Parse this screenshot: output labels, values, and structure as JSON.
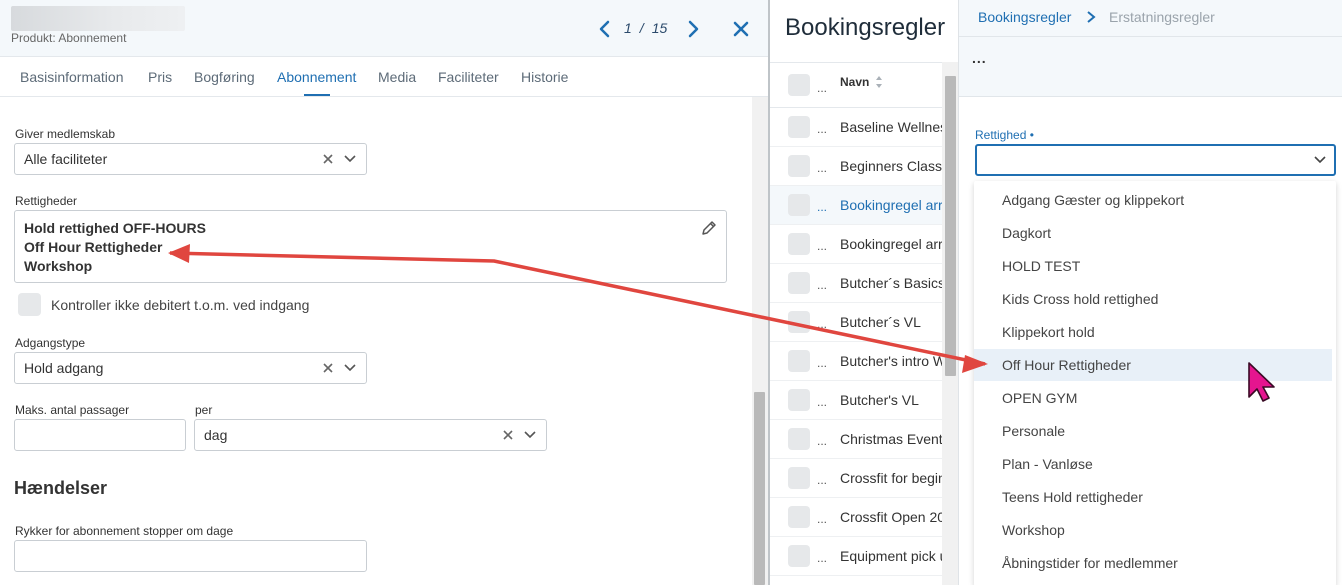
{
  "left_panel": {
    "subtitle": "Produkt: Abonnement",
    "pager": {
      "current": "1",
      "separator": "/",
      "total": "15"
    },
    "tabs": [
      {
        "label": "Basisinformation"
      },
      {
        "label": "Pris"
      },
      {
        "label": "Bogføring"
      },
      {
        "label": "Abonnement",
        "active": true
      },
      {
        "label": "Media"
      },
      {
        "label": "Faciliteter"
      },
      {
        "label": "Historie"
      }
    ],
    "form": {
      "membership_label": "Giver medlemskab",
      "membership_value": "Alle faciliteter",
      "rights_label": "Rettigheder",
      "rights_values": [
        "Hold rettighed OFF-HOURS",
        "Off Hour Rettigheder",
        "Workshop"
      ],
      "check_label": "Kontroller ikke debitert t.o.m. ved indgang",
      "access_label": "Adgangstype",
      "access_value": "Hold adgang",
      "max_label": "Maks. antal passager",
      "max_value": "",
      "per_label": "per",
      "per_value": "dag",
      "events_heading": "Hændelser",
      "reminder_label": "Rykker for abonnement stopper om dage",
      "reminder_value": ""
    }
  },
  "middle_panel": {
    "title": "Bookingsregler",
    "column_header": "Navn",
    "row_dots": "...",
    "rows": [
      {
        "name": "Baseline Wellness"
      },
      {
        "name": "Beginners Class"
      },
      {
        "name": "Bookingregel arr",
        "highlighted": true
      },
      {
        "name": "Bookingregel arr"
      },
      {
        "name": "Butcher´s Basics"
      },
      {
        "name": "Butcher´s VL"
      },
      {
        "name": "Butcher's intro W"
      },
      {
        "name": "Butcher's VL"
      },
      {
        "name": "Christmas Event"
      },
      {
        "name": "Crossfit for begin"
      },
      {
        "name": "Crossfit Open 20"
      },
      {
        "name": "Equipment pick u"
      }
    ]
  },
  "right_panel": {
    "breadcrumb_link": "Bookingsregler",
    "breadcrumb_current": "Erstatningsregler",
    "toolbar_dots": "...",
    "field_label": "Rettighed •",
    "field_value": "",
    "options": [
      {
        "label": "Adgang Gæster og klippekort"
      },
      {
        "label": "Dagkort"
      },
      {
        "label": "HOLD TEST"
      },
      {
        "label": "Kids Cross hold rettighed"
      },
      {
        "label": "Klippekort hold"
      },
      {
        "label": "Off Hour Rettigheder",
        "hovered": true
      },
      {
        "label": "OPEN GYM"
      },
      {
        "label": "Personale"
      },
      {
        "label": "Plan - Vanløse"
      },
      {
        "label": "Teens Hold rettigheder"
      },
      {
        "label": "Workshop"
      },
      {
        "label": "Åbningstider for medlemmer"
      }
    ]
  },
  "colors": {
    "accent": "#1f6fb2",
    "annotation_arrow": "#e0463f",
    "cursor": "#e5158f"
  },
  "icons": [
    "chevron-left-icon",
    "chevron-right-icon",
    "close-icon",
    "clear-icon",
    "chevron-down-icon",
    "pencil-icon",
    "sort-icon",
    "breadcrumb-chevron-icon",
    "mouse-cursor-icon"
  ]
}
